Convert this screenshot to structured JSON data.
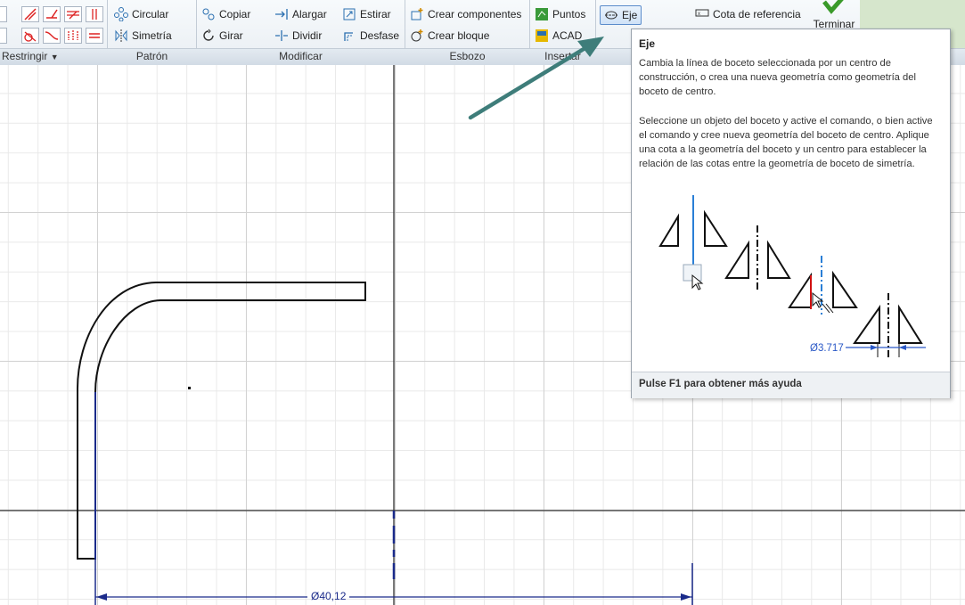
{
  "ribbon": {
    "constrain": {
      "label": "Restringir"
    },
    "pattern": {
      "label": "Patrón",
      "circular": "Circular",
      "mirror": "Simetría"
    },
    "modify": {
      "label": "Modificar",
      "copy": "Copiar",
      "rotate": "Girar",
      "extend": "Alargar",
      "split": "Dividir",
      "stretch": "Estirar",
      "offset": "Desfase"
    },
    "layout": {
      "label": "Esbozo",
      "create_components": "Crear componentes",
      "create_block": "Crear bloque"
    },
    "insert": {
      "label": "Insertar",
      "points": "Puntos",
      "acad": "ACAD"
    },
    "format": {
      "axis": "Eje",
      "reference_dimension": "Cota de referencia"
    },
    "finish": {
      "label": "Terminar"
    }
  },
  "tooltip": {
    "title": "Eje",
    "paragraph1": "Cambia la línea de boceto seleccionada por un centro de construcción, o crea una nueva geometría como geometría del boceto de centro.",
    "paragraph2": "Seleccione un objeto del boceto y active el comando, o bien active el comando y cree nueva geometría del boceto de centro. Aplique una cota a la geometría del boceto y un centro para establecer la relación de las cotas entre la geometría de boceto de simetría.",
    "illustration_dimension": "Ø3.717",
    "footer": "Pulse F1 para obtener más ayuda"
  },
  "sketch": {
    "dimension_label": "Ø40,12"
  },
  "colors": {
    "accent_arrow": "#3e7d7a",
    "dimension": "#1a2a8a",
    "highlight_blue": "#2a7fd6",
    "highlight_red": "#d01010"
  }
}
